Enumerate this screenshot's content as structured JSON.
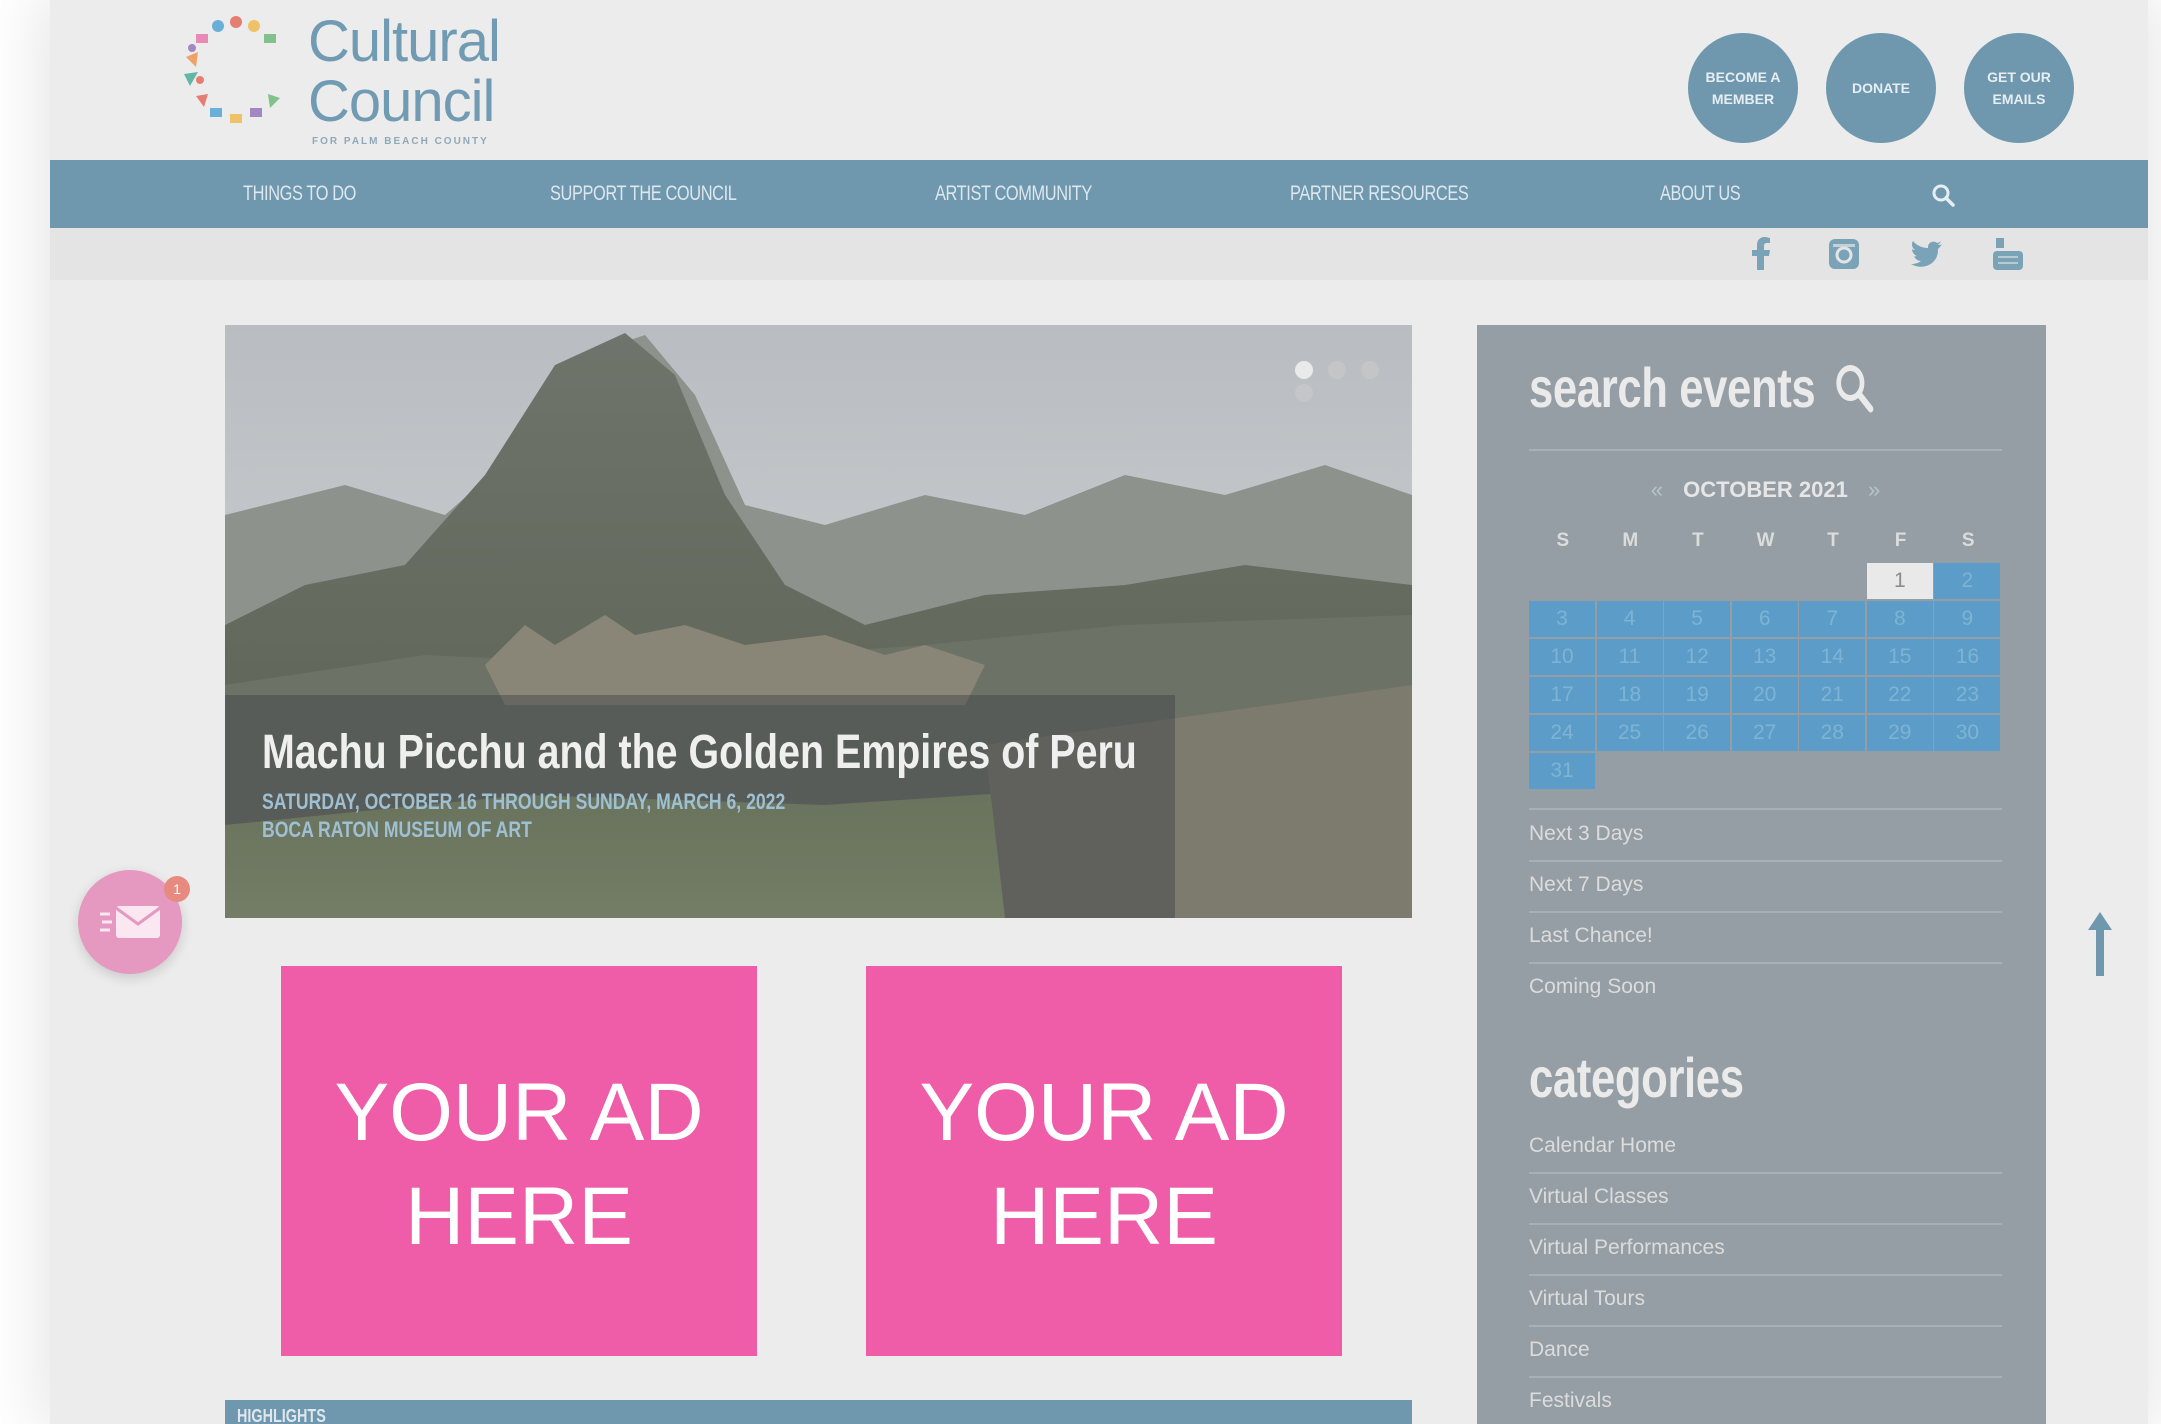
{
  "header": {
    "logo_line1": "Cultural",
    "logo_line2": "Council",
    "logo_sub": "FOR PALM BEACH COUNTY",
    "buttons": [
      "BECOME A MEMBER",
      "DONATE",
      "GET OUR EMAILS"
    ]
  },
  "nav": {
    "items": [
      "THINGS TO DO",
      "SUPPORT THE COUNCIL",
      "ARTIST COMMUNITY",
      "PARTNER RESOURCES",
      "ABOUT US"
    ],
    "search_icon": "search-icon"
  },
  "social": [
    "facebook-icon",
    "instagram-icon",
    "twitter-icon",
    "youtube-icon"
  ],
  "hero": {
    "title": "Machu Picchu and the Golden Empires of Peru",
    "date": "SATURDAY, OCTOBER 16 THROUGH SUNDAY, MARCH 6, 2022",
    "venue": "BOCA RATON MUSEUM OF ART",
    "slide_count": 4,
    "active_slide": 1
  },
  "ads": [
    {
      "line1": "YOUR AD",
      "line2": "HERE"
    },
    {
      "line1": "YOUR AD",
      "line2": "HERE"
    }
  ],
  "highlights_label": "HIGHLIGHTS",
  "mail_badge": "1",
  "sidebar": {
    "search_title": "search events",
    "calendar": {
      "prev": "«",
      "month": "OCTOBER 2021",
      "next": "»",
      "weekdays": [
        "S",
        "M",
        "T",
        "W",
        "T",
        "F",
        "S"
      ],
      "weeks": [
        [
          "",
          "",
          "",
          "",
          "",
          "1",
          "2"
        ],
        [
          "3",
          "4",
          "5",
          "6",
          "7",
          "8",
          "9"
        ],
        [
          "10",
          "11",
          "12",
          "13",
          "14",
          "15",
          "16"
        ],
        [
          "17",
          "18",
          "19",
          "20",
          "21",
          "22",
          "23"
        ],
        [
          "24",
          "25",
          "26",
          "27",
          "28",
          "29",
          "30"
        ],
        [
          "31",
          "",
          "",
          "",
          "",
          "",
          ""
        ]
      ],
      "today": "1"
    },
    "quick_links": [
      "Next 3 Days",
      "Next 7 Days",
      "Last Chance!",
      "Coming Soon"
    ],
    "categories_title": "categories",
    "categories": [
      "Calendar Home",
      "Virtual Classes",
      "Virtual Performances",
      "Virtual Tours",
      "Dance",
      "Festivals"
    ]
  },
  "colors": {
    "nav_blue": "#6f98ae",
    "ad_pink": "#ef5ca8",
    "sidebar_gray": "#959ea4",
    "calendar_blue": "#5b9dc8"
  }
}
